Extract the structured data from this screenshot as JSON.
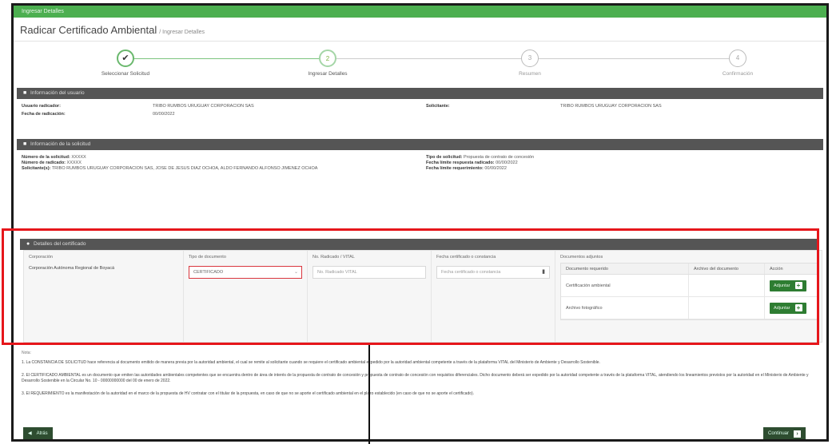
{
  "topbar": {
    "label": "Ingresar Detalles"
  },
  "page": {
    "title": "Radicar Certificado Ambiental",
    "subtitle": "/ Ingresar Detalles"
  },
  "stepper": {
    "steps": [
      {
        "label": "Seleccionar Solicitud",
        "number": "✔",
        "state": "done"
      },
      {
        "label": "Ingresar Detalles",
        "number": "2",
        "state": "current"
      },
      {
        "label": "Resumen",
        "number": "3",
        "state": "pending"
      },
      {
        "label": "Confirmación",
        "number": "4",
        "state": "pending"
      }
    ]
  },
  "radicado_section": {
    "title": "Información del usuario",
    "fields": [
      {
        "key": "Usuario radicador:",
        "value": "TRIBO RUMBOS URUGUAY CORPORACION SAS"
      },
      {
        "key": "Fecha de radicación:",
        "value": "00/00/2022"
      },
      {
        "key": "Solicitante:",
        "value": "TRIBO RUMBOS URUGUAY CORPORACION SAS"
      }
    ]
  },
  "solicitud_section": {
    "title": "Información de la solicitud",
    "left": [
      {
        "key": "Número de la solicitud:",
        "value": "XXXXX"
      },
      {
        "key": "Número de radicado:",
        "value": "XXXXX"
      },
      {
        "key": "Solicitante(s):",
        "value": "TRIBO RUMBOS URUGUAY CORPORACION SAS, JOSE DE JESUS DIAZ OCHOA, ALDO FERNANDO ALFONSO JIMENEZ OCHOA"
      }
    ],
    "right": [
      {
        "key": "Tipo de solicitud:",
        "value": "Propuesta de contrato de concesión"
      },
      {
        "key": "Fecha límite respuesta radicado:",
        "value": "00/00/2022"
      },
      {
        "key": "Fecha límite requerimiento:",
        "value": "00/00/2022"
      }
    ]
  },
  "detalles": {
    "title": "Detalles del certificado",
    "columns": {
      "corporacion_label": "Corporación",
      "corporacion_value": "Corporación Autónoma Regional de Boyacá",
      "tipo_label": "Tipo de documento",
      "tipo_value": "CERTIFICADO",
      "radicado_label": "No. Radicado / VITAL",
      "radicado_placeholder": "No. Radicado VITAL",
      "fecha_label": "Fecha certificado o constancia",
      "fecha_placeholder": "Fecha certificado o constancia",
      "docs_label": "Documentos adjuntos"
    },
    "doc_table": {
      "headers": [
        "Documento requerido",
        "Archivo del documento",
        "Acción"
      ],
      "rows": [
        {
          "doc": "Certificación ambiental",
          "file": "",
          "action": "Adjuntar"
        },
        {
          "doc": "Archivo fotográfico",
          "file": "",
          "action": "Adjuntar"
        }
      ]
    }
  },
  "notes": {
    "heading": "Nota:",
    "items": [
      "1. La CONSTANCIA DE SOLICITUD hace referencia al documento emitido de manera previa por la autoridad ambiental, el cual se remite al solicitante cuando se requiere el certificado ambiental expedido por la autoridad ambiental competente a través de la plataforma VITAL del Ministerio de Ambiente y Desarrollo Sostenible.",
      "2. El CERTIFICADO AMBIENTAL es un documento que emiten las autoridades ambientales competentes que se encuentra dentro de área de interés de la propuesta de contrato de concesión y propuesta de contrato de concesión con requisitos diferenciales. Dicho documento deberá ser expedido por la autoridad competente a través de la plataforma VITAL, atendiendo los lineamientos previstos por la autoridad en el Ministerio de Ambiente y Desarrollo Sostenible en la Circular No. 10 - 00000000000 del 00 de enero de 2022.",
      "3. El REQUERIMIENTO es la manifestación de la autoridad en el marco de la propuesta de HV contratar con el titular de la propuesta, en caso de que no se aporte el certificado ambiental en el plazo establecido (en caso de que no se aporte el certificado)."
    ]
  },
  "footer": {
    "back_label": "Atrás",
    "next_label": "Continuar"
  }
}
